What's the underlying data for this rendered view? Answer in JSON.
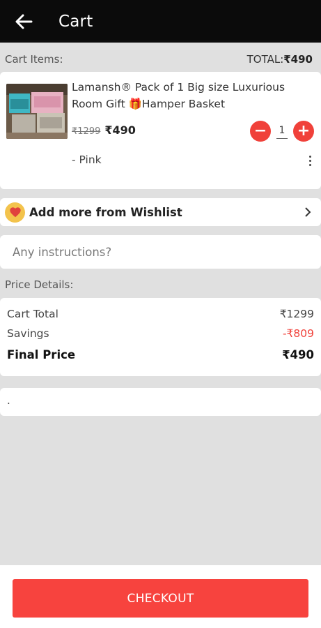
{
  "appbar": {
    "title": "Cart"
  },
  "cart": {
    "items_label": "Cart Items:",
    "total_label": "TOTAL:",
    "total_value": "₹490"
  },
  "item": {
    "title": "Lamansh® Pack of 1 Big size Luxurious Room Gift 🎁Hamper Basket",
    "mrp": "₹1299",
    "price": "₹490",
    "quantity": "1",
    "variant": "- Pink",
    "minus_label": "−",
    "plus_label": "+"
  },
  "wishlist": {
    "label": "Add more from Wishlist"
  },
  "instructions": {
    "placeholder": "Any instructions?"
  },
  "price_details": {
    "label": "Price Details:",
    "rows": [
      {
        "label": "Cart Total",
        "value": "₹1299"
      },
      {
        "label": "Savings",
        "value": "-₹809"
      },
      {
        "label": "Final Price",
        "value": "₹490"
      }
    ]
  },
  "note": {
    "text": "."
  },
  "checkout": {
    "label": "CHECKOUT"
  },
  "colors": {
    "accent": "#f0413a",
    "appbar": "#0b0b0b",
    "background": "#e0e0e0"
  }
}
